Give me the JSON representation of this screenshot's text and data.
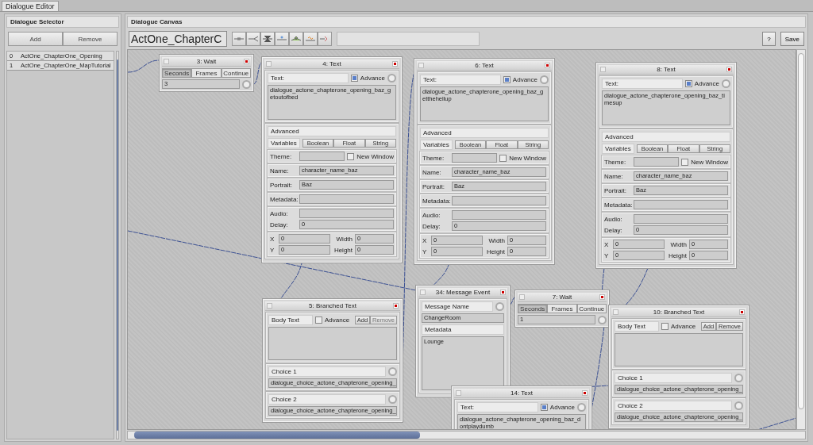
{
  "window": {
    "tab": "Dialogue Editor"
  },
  "selector": {
    "title": "Dialogue Selector",
    "buttons": [
      "Add",
      "Remove"
    ],
    "items": [
      {
        "index": "0",
        "name": "ActOne_ChapterOne_Opening"
      },
      {
        "index": "1",
        "name": "ActOne_ChapterOne_MapTutorial"
      }
    ]
  },
  "canvas": {
    "title": "Dialogue Canvas",
    "name_field": "ActOne_ChapterC",
    "help": "?",
    "save": "Save"
  },
  "nodes": [
    {
      "kind": "wait",
      "title": "3: Wait",
      "tabs": [
        {
          "label": "Seconds",
          "selected": true
        },
        {
          "label": "Frames",
          "selected": false
        },
        {
          "label": "Continue",
          "selected": false
        }
      ],
      "value": "3"
    },
    {
      "kind": "text",
      "title": "4: Text",
      "text_label": "Text:",
      "advanced": {
        "label": "Advance",
        "checked": true
      },
      "body": "dialogue_actone_chapterone_opening_baz_getoutofbed",
      "section": "Advanced",
      "variables": "Variables",
      "var_types": [
        "Boolean",
        "Float",
        "String"
      ],
      "theme_label": "Theme:",
      "new_window": {
        "label": "New Window",
        "checked": false
      },
      "fields": [
        {
          "label": "Name:",
          "value": "character_name_baz"
        },
        {
          "label": "Portrait:",
          "value": "Baz"
        },
        {
          "label": "Metadata:"
        }
      ],
      "audio_label": "Audio:",
      "delay": {
        "label": "Delay:",
        "value": "0"
      },
      "rect": [
        {
          "label": "X",
          "value": "0"
        },
        {
          "label": "Width",
          "value": "0"
        },
        {
          "label": "Y",
          "value": "0"
        },
        {
          "label": "Height",
          "value": "0"
        }
      ]
    },
    {
      "kind": "text",
      "title": "6: Text",
      "text_label": "Text:",
      "advanced": {
        "label": "Advance",
        "checked": true
      },
      "body": "dialogue_actone_chapterone_opening_baz_getthehellup",
      "section": "Advanced",
      "variables": "Variables",
      "var_types": [
        "Boolean",
        "Float",
        "String"
      ],
      "theme_label": "Theme:",
      "new_window": {
        "label": "New Window",
        "checked": false
      },
      "fields": [
        {
          "label": "Name:",
          "value": "character_name_baz"
        },
        {
          "label": "Portrait:",
          "value": "Baz"
        },
        {
          "label": "Metadata:"
        }
      ],
      "audio_label": "Audio:",
      "delay": {
        "label": "Delay:",
        "value": "0"
      },
      "rect": [
        {
          "label": "X",
          "value": "0"
        },
        {
          "label": "Width",
          "value": "0"
        },
        {
          "label": "Y",
          "value": "0"
        },
        {
          "label": "Height",
          "value": "0"
        }
      ]
    },
    {
      "kind": "text",
      "title": "8: Text",
      "text_label": "Text:",
      "advanced": {
        "label": "Advance",
        "checked": true
      },
      "body": "dialogue_actone_chapterone_opening_baz_timesup",
      "section": "Advanced",
      "variables": "Variables",
      "var_types": [
        "Boolean",
        "Float",
        "String"
      ],
      "theme_label": "Theme:",
      "new_window": {
        "label": "New Window",
        "checked": false
      },
      "fields": [
        {
          "label": "Name:",
          "value": "character_name_baz"
        },
        {
          "label": "Portrait:",
          "value": "Baz"
        },
        {
          "label": "Metadata:"
        }
      ],
      "audio_label": "Audio:",
      "delay": {
        "label": "Delay:",
        "value": "0"
      },
      "rect": [
        {
          "label": "X",
          "value": "0"
        },
        {
          "label": "Width",
          "value": "0"
        },
        {
          "label": "Y",
          "value": "0"
        },
        {
          "label": "Height",
          "value": "0"
        }
      ]
    },
    {
      "kind": "message",
      "title": "34: Message Event",
      "name_label": "Message Name",
      "name_value": "ChangeRoom",
      "meta_label": "Metadata",
      "meta_value": "Lounge"
    },
    {
      "kind": "wait",
      "title": "7: Wait",
      "tabs": [
        {
          "label": "Seconds",
          "selected": true
        },
        {
          "label": "Frames",
          "selected": false
        },
        {
          "label": "Continue",
          "selected": false
        }
      ],
      "value": "1"
    },
    {
      "kind": "branched",
      "title": "5: Branched Text",
      "body_label": "Body Text",
      "advanced": {
        "label": "Advance",
        "checked": false
      },
      "add": "Add",
      "remove": {
        "label": "Remove",
        "disabled": true
      },
      "choices": [
        {
          "label": "Choice 1",
          "value": "dialogue_choice_actone_chapterone_opening_"
        },
        {
          "label": "Choice 2",
          "value": "dialogue_choice_actone_chapterone_opening_"
        }
      ]
    },
    {
      "kind": "branched",
      "title": "10: Branched Text",
      "body_label": "Body Text",
      "advanced": {
        "label": "Advance",
        "checked": false
      },
      "add": "Add",
      "remove": {
        "label": "Remove",
        "disabled": false
      },
      "choices": [
        {
          "label": "Choice 1",
          "value": "dialogue_choice_actone_chapterone_opening_"
        },
        {
          "label": "Choice 2",
          "value": "dialogue_choice_actone_chapterone_opening_"
        }
      ]
    },
    {
      "kind": "text",
      "title": "14: Text",
      "text_label": "Text:",
      "advanced": {
        "label": "Advance",
        "checked": true
      },
      "body": "dialogue_actone_chapterone_opening_baz_dontplaydumb"
    }
  ]
}
